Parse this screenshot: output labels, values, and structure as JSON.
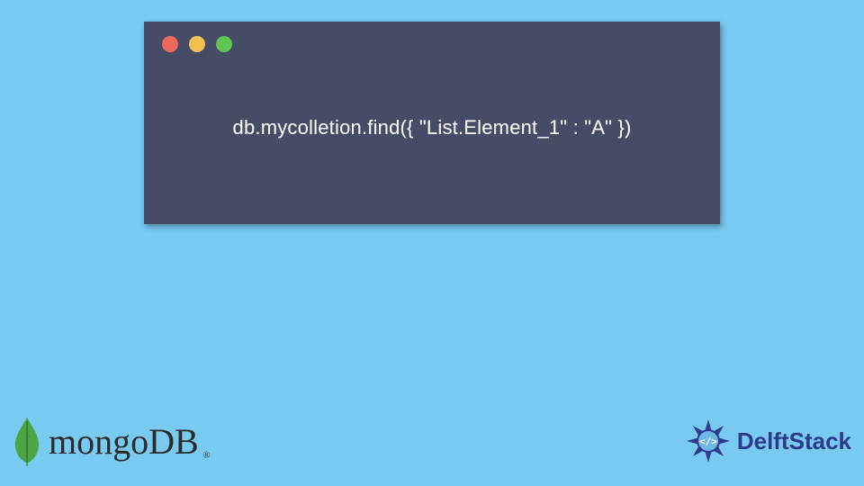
{
  "card": {
    "window_controls": {
      "red_icon": "close",
      "yellow_icon": "minimize",
      "green_icon": "zoom"
    },
    "code_line": "db.mycolletion.find({ \"List.Element_1\" : \"A\" })"
  },
  "colors": {
    "page_bg": "#78caf1",
    "card_bg": "#464c66",
    "code_text": "#ffffff",
    "dot_red": "#ee695d",
    "dot_yellow": "#f3bf4f",
    "dot_green": "#61c554",
    "mongo_leaf": "#4ca445",
    "mongo_text": "#2b2b2b",
    "delft_blue": "#2e3a8c"
  },
  "bottom_left": {
    "brand": "mongoDB",
    "registered_mark": "®"
  },
  "bottom_right": {
    "brand": "DelftStack",
    "badge_glyph": "</>"
  }
}
